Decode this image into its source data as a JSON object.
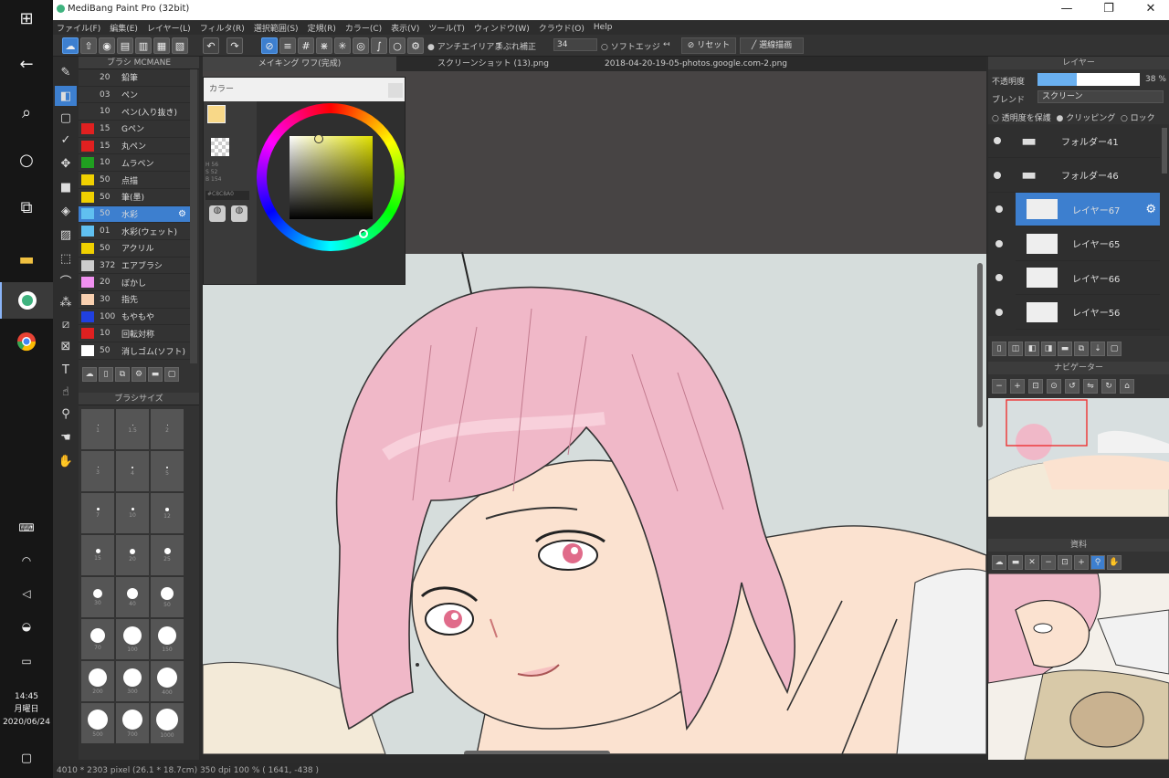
{
  "window": {
    "title": "MediBang Paint Pro (32bit)",
    "min": "—",
    "max": "❐",
    "close": "✕"
  },
  "menu": [
    "ファイル(F)",
    "編集(E)",
    "レイヤー(L)",
    "フィルタ(R)",
    "選択範囲(S)",
    "定規(R)",
    "カラー(C)",
    "表示(V)",
    "ツール(T)",
    "ウィンドウ(W)",
    "クラウド(O)",
    "Help"
  ],
  "toolbar": {
    "antialias": "アンチエイリアス",
    "correction_label": "手ぶれ補正",
    "correction_value": "34",
    "softedge": "ソフトエッジ",
    "reset_label": "リセット",
    "fill_label": "選線描画"
  },
  "taskbar": {
    "time": "14:45",
    "day": "月曜日",
    "date": "2020/06/24"
  },
  "brush_panel": {
    "title": "ブラシ MCMANE",
    "brushes": [
      {
        "size": "20",
        "name": "鉛筆",
        "color": "#333333"
      },
      {
        "size": "03",
        "name": "ペン",
        "color": "#333333"
      },
      {
        "size": "10",
        "name": "ペン(入り抜き)",
        "color": "#333333"
      },
      {
        "size": "15",
        "name": "Gペン",
        "color": "#e02020"
      },
      {
        "size": "15",
        "name": "丸ペン",
        "color": "#e02020"
      },
      {
        "size": "10",
        "name": "ムラペン",
        "color": "#20a020"
      },
      {
        "size": "50",
        "name": "点描",
        "color": "#f0d000"
      },
      {
        "size": "50",
        "name": "筆(墨)",
        "color": "#f0d000"
      },
      {
        "size": "50",
        "name": "水彩",
        "color": "#60c0f0"
      },
      {
        "size": "01",
        "name": "水彩(ウェット)",
        "color": "#60c0f0"
      },
      {
        "size": "50",
        "name": "アクリル",
        "color": "#f0d000"
      },
      {
        "size": "372",
        "name": "エアブラシ",
        "color": "#cccccc"
      },
      {
        "size": "20",
        "name": "ぼかし",
        "color": "#f090f0"
      },
      {
        "size": "30",
        "name": "指先",
        "color": "#f8d0b0"
      },
      {
        "size": "100",
        "name": "もやもや",
        "color": "#2040e0"
      },
      {
        "size": "10",
        "name": "回転対称",
        "color": "#e02020"
      },
      {
        "size": "50",
        "name": "消しゴム(ソフト)",
        "color": "#ffffff"
      }
    ]
  },
  "size_panel": {
    "title": "ブラシサイズ",
    "sizes": [
      "1",
      "1.5",
      "2",
      "3",
      "4",
      "5",
      "7",
      "10",
      "12",
      "15",
      "20",
      "25",
      "30",
      "40",
      "50",
      "70",
      "100",
      "150",
      "200",
      "300",
      "400",
      "500",
      "700",
      "1000"
    ]
  },
  "tabs": [
    "メイキング ワフ(完成)",
    "スクリーンショット (13).png",
    "2018-04-20-19-05-photos.google.com-2.png"
  ],
  "color_panel": {
    "title": "カラー",
    "hsv": [
      "H 56",
      "S 52",
      "B 154"
    ],
    "hex": "#C8C8A0"
  },
  "layer_panel": {
    "title": "レイヤー",
    "opacity_label": "不透明度",
    "opacity_value": "38 %",
    "blend_label": "ブレンド",
    "blend_value": "スクリーン",
    "options": [
      "透明度を保護",
      "クリッピング",
      "ロック"
    ],
    "layers": [
      {
        "name": "フォルダー41",
        "type": "folder"
      },
      {
        "name": "フォルダー46",
        "type": "folder"
      },
      {
        "name": "レイヤー67",
        "type": "layer",
        "selected": true
      },
      {
        "name": "レイヤー65",
        "type": "layer"
      },
      {
        "name": "レイヤー66",
        "type": "layer"
      },
      {
        "name": "レイヤー56",
        "type": "layer"
      }
    ]
  },
  "navigator": {
    "title": "ナビゲーター"
  },
  "reference": {
    "title": "資料"
  },
  "status": "4010 * 2303 pixel  (26.1 * 18.7cm)  350 dpi  100 %  ( 1641, -438 )",
  "colors": {
    "accent": "#3d7fcf",
    "hair": "#f0b8c8",
    "skin": "#fbe2d0",
    "bg": "#d6dddc"
  }
}
